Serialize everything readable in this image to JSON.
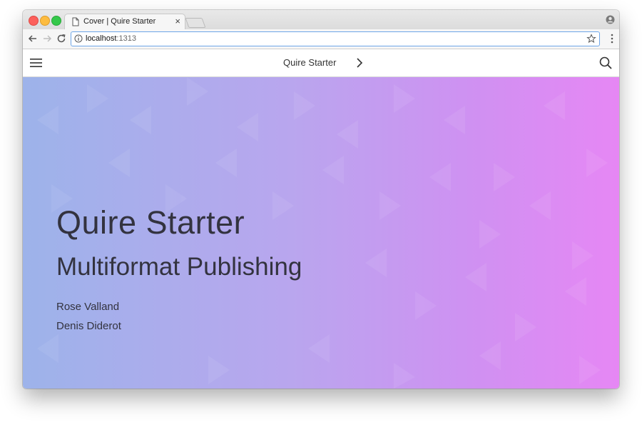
{
  "browser": {
    "tab_title": "Cover | Quire Starter",
    "tab_close": "×",
    "url_host": "localhost",
    "url_port": ":1313"
  },
  "site": {
    "title": "Quire Starter"
  },
  "hero": {
    "title": "Quire Starter",
    "subtitle": "Multiformat Publishing",
    "authors": [
      "Rose Valland",
      "Denis Diderot"
    ]
  },
  "colors": {
    "gradient_start": "#9db3ea",
    "gradient_end": "#e687f4",
    "text": "#33333f",
    "omnibox_focus": "#6ea6e8"
  },
  "icons": [
    "page-icon",
    "close-icon",
    "profile-icon",
    "back-arrow-icon",
    "forward-arrow-icon",
    "reload-icon",
    "info-icon",
    "star-icon",
    "more-vert-icon",
    "hamburger-icon",
    "chevron-right-icon",
    "search-icon"
  ]
}
